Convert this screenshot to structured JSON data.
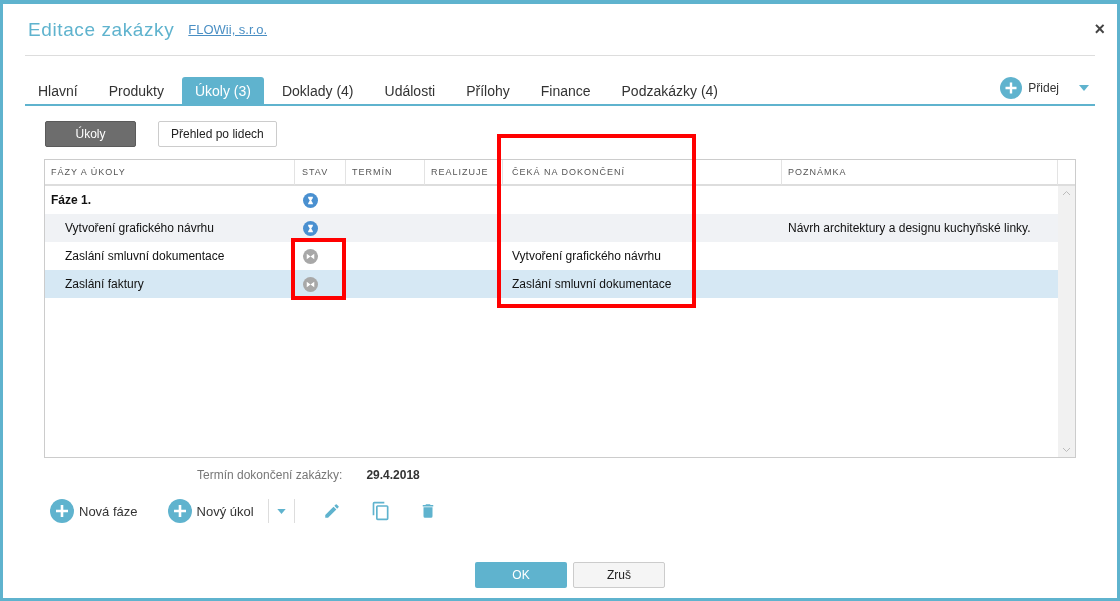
{
  "window": {
    "title": "Editace zakázky",
    "link": "FLOWii, s.r.o.",
    "close": "×"
  },
  "tabs": [
    {
      "label": "Hlavní",
      "selected": false
    },
    {
      "label": "Produkty",
      "selected": false
    },
    {
      "label": "Úkoly (3)",
      "selected": true
    },
    {
      "label": "Doklady (4)",
      "selected": false
    },
    {
      "label": "Události",
      "selected": false
    },
    {
      "label": "Přílohy",
      "selected": false
    },
    {
      "label": "Finance",
      "selected": false
    },
    {
      "label": "Podzakázky (4)",
      "selected": false
    }
  ],
  "add_menu": {
    "label": "Přidej"
  },
  "views": [
    {
      "label": "Úkoly",
      "selected": true
    },
    {
      "label": "Přehled po lidech",
      "selected": false
    }
  ],
  "table": {
    "columns": [
      {
        "kind": "name",
        "label": "FÁZY A ÚKOLY",
        "outlined": false
      },
      {
        "kind": "status",
        "label": "STAV",
        "outlined": true
      },
      {
        "kind": "date",
        "label": "TERMÍN",
        "outlined": false
      },
      {
        "kind": "person",
        "label": "REALIZUJE",
        "outlined": false
      },
      {
        "kind": "waits",
        "label": "ČEKÁ NA DOKONČENÍ",
        "outlined": true
      },
      {
        "kind": "note",
        "label": "POZNÁMKA",
        "outlined": false
      }
    ],
    "rows": [
      {
        "kind": "phase",
        "name": "Fáze 1.",
        "waiting": false,
        "selected": false
      },
      {
        "kind": "task",
        "name": "Vytvoření grafického návrhu",
        "waiting": false,
        "note": "Návrh architektury a designu kuchyňské linky.",
        "selected": false
      },
      {
        "kind": "task",
        "name": "Zaslání smluvní dokumentace",
        "waiting": true,
        "waits_for": "Vytvoření grafického návrhu",
        "selected": false
      },
      {
        "kind": "task",
        "name": "Zaslání faktury",
        "waiting": true,
        "waits_for": "Zaslání smluvní dokumentace",
        "selected": true
      }
    ]
  },
  "deadline": {
    "label": "Termín dokončení zakázky:",
    "value": "29.4.2018"
  },
  "toolbar": {
    "new_phase": "Nová fáze",
    "new_task": "Nový úkol"
  },
  "buttons": {
    "ok": "OK",
    "cancel": "Zruš"
  }
}
